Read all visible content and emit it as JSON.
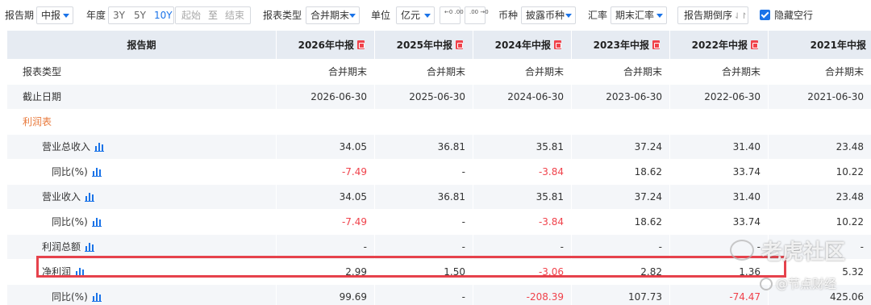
{
  "toolbar": {
    "report_period_label": "报告期",
    "report_period_value": "中报",
    "year_label": "年度",
    "year_options": [
      "3Y",
      "5Y",
      "10Y"
    ],
    "year_active": "10Y",
    "start_placeholder": "起始",
    "to_label": "至",
    "end_placeholder": "结束",
    "report_type_label": "报表类型",
    "report_type_value": "合并期末",
    "unit_label": "单位",
    "unit_value": "亿元",
    "decimal_increase": "←0 .00",
    "decimal_decrease": ".00 →0",
    "currency_label": "币种",
    "currency_value": "披露币种",
    "rate_label": "汇率",
    "rate_value": "期末汇率",
    "sort_label": "报告期倒序",
    "hide_empty_label": "隐藏空行",
    "hide_empty_checked": true
  },
  "table": {
    "header_label": "报告期",
    "columns": [
      "2026年中报",
      "2025年中报",
      "2024年中报",
      "2023年中报",
      "2022年中报",
      "2021年中报"
    ],
    "rows": [
      {
        "label": "报表类型",
        "level": 0,
        "values": [
          "合并期末",
          "合并期末",
          "合并期末",
          "合并期末",
          "合并期末",
          "合并期末"
        ]
      },
      {
        "label": "截止日期",
        "level": 0,
        "values": [
          "2026-06-30",
          "2025-06-30",
          "2024-06-30",
          "2023-06-30",
          "2022-06-30",
          "2021-06-30"
        ]
      },
      {
        "label": "利润表",
        "level": 0,
        "section": true,
        "values": [
          "",
          "",
          "",
          "",
          "",
          ""
        ]
      },
      {
        "label": "营业总收入",
        "level": 1,
        "values": [
          "34.05",
          "36.81",
          "35.81",
          "37.24",
          "31.40",
          "23.48"
        ]
      },
      {
        "label": "同比(%)",
        "level": 2,
        "values": [
          "-7.49",
          "-",
          "-3.84",
          "18.62",
          "33.74",
          "10.22"
        ]
      },
      {
        "label": "营业收入",
        "level": 1,
        "values": [
          "34.05",
          "36.81",
          "35.81",
          "37.24",
          "31.40",
          "23.48"
        ]
      },
      {
        "label": "同比(%)",
        "level": 2,
        "values": [
          "-7.49",
          "-",
          "-3.84",
          "18.62",
          "33.74",
          "10.22"
        ]
      },
      {
        "label": "利润总额",
        "level": 1,
        "values": [
          "-",
          "-",
          "-",
          "-",
          "-",
          "-"
        ]
      },
      {
        "label": "净利润",
        "level": 1,
        "values": [
          "2.99",
          "1.50",
          "-3.06",
          "2.82",
          "1.36",
          "5.32"
        ]
      },
      {
        "label": "同比(%)",
        "level": 2,
        "values": [
          "99.69",
          "-",
          "-208.39",
          "107.73",
          "-74.47",
          "425.06"
        ]
      }
    ]
  },
  "watermark": {
    "line1": "老虎社区",
    "line2": "@节点财经"
  },
  "colors": {
    "accent": "#1a73e8",
    "negative": "#f0424b",
    "section": "#e8793b",
    "highlight_border": "#e6424c",
    "header_bg": "#e6ebf2",
    "zebra_bg": "#f4f6f9"
  }
}
